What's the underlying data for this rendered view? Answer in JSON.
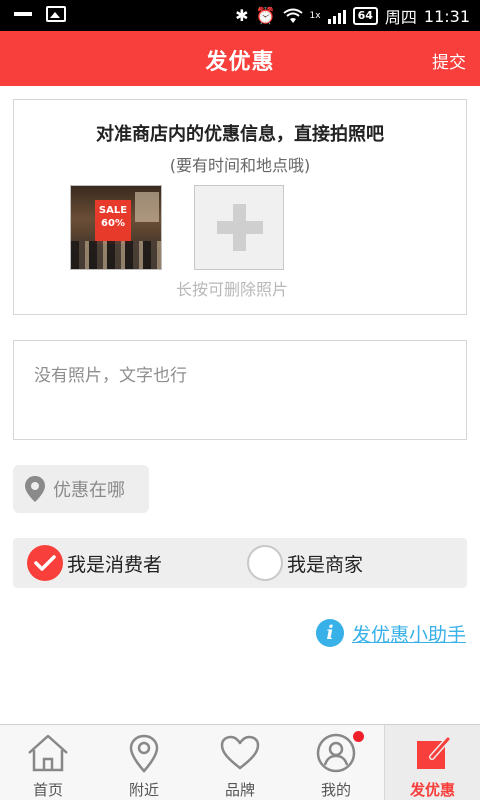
{
  "status_bar": {
    "bluetooth_icon": "bluetooth-icon",
    "alarm_icon": "alarm-icon",
    "wifi_icon": "wifi-icon",
    "signal_type": "1x",
    "battery": "64",
    "weekday": "周四",
    "time": "11:31"
  },
  "header": {
    "title": "发优惠",
    "submit_label": "提交",
    "background_color": "#f83f3c"
  },
  "photo_section": {
    "heading": "对准商店内的优惠信息，直接拍照吧",
    "subheading": "(要有时间和地点哦)",
    "thumbnail_sign_line1": "SALE",
    "thumbnail_sign_line2": "60%",
    "hint": "长按可删除照片"
  },
  "description": {
    "placeholder": "没有照片，文字也行",
    "value": ""
  },
  "location": {
    "label": "优惠在哪",
    "icon": "location-pin-icon"
  },
  "role_selector": {
    "options": [
      {
        "label": "我是消费者",
        "selected": true
      },
      {
        "label": "我是商家",
        "selected": false
      }
    ],
    "accent_color": "#f83f3c"
  },
  "helper": {
    "label": "发优惠小助手",
    "icon": "info-icon",
    "color": "#38b0e8"
  },
  "bottom_nav": {
    "items": [
      {
        "label": "首页",
        "icon": "home-icon"
      },
      {
        "label": "附近",
        "icon": "location-pin-icon"
      },
      {
        "label": "品牌",
        "icon": "heart-icon"
      },
      {
        "label": "我的",
        "icon": "user-icon",
        "has_notification": true
      },
      {
        "label": "发优惠",
        "icon": "edit-icon",
        "active": true
      }
    ]
  }
}
